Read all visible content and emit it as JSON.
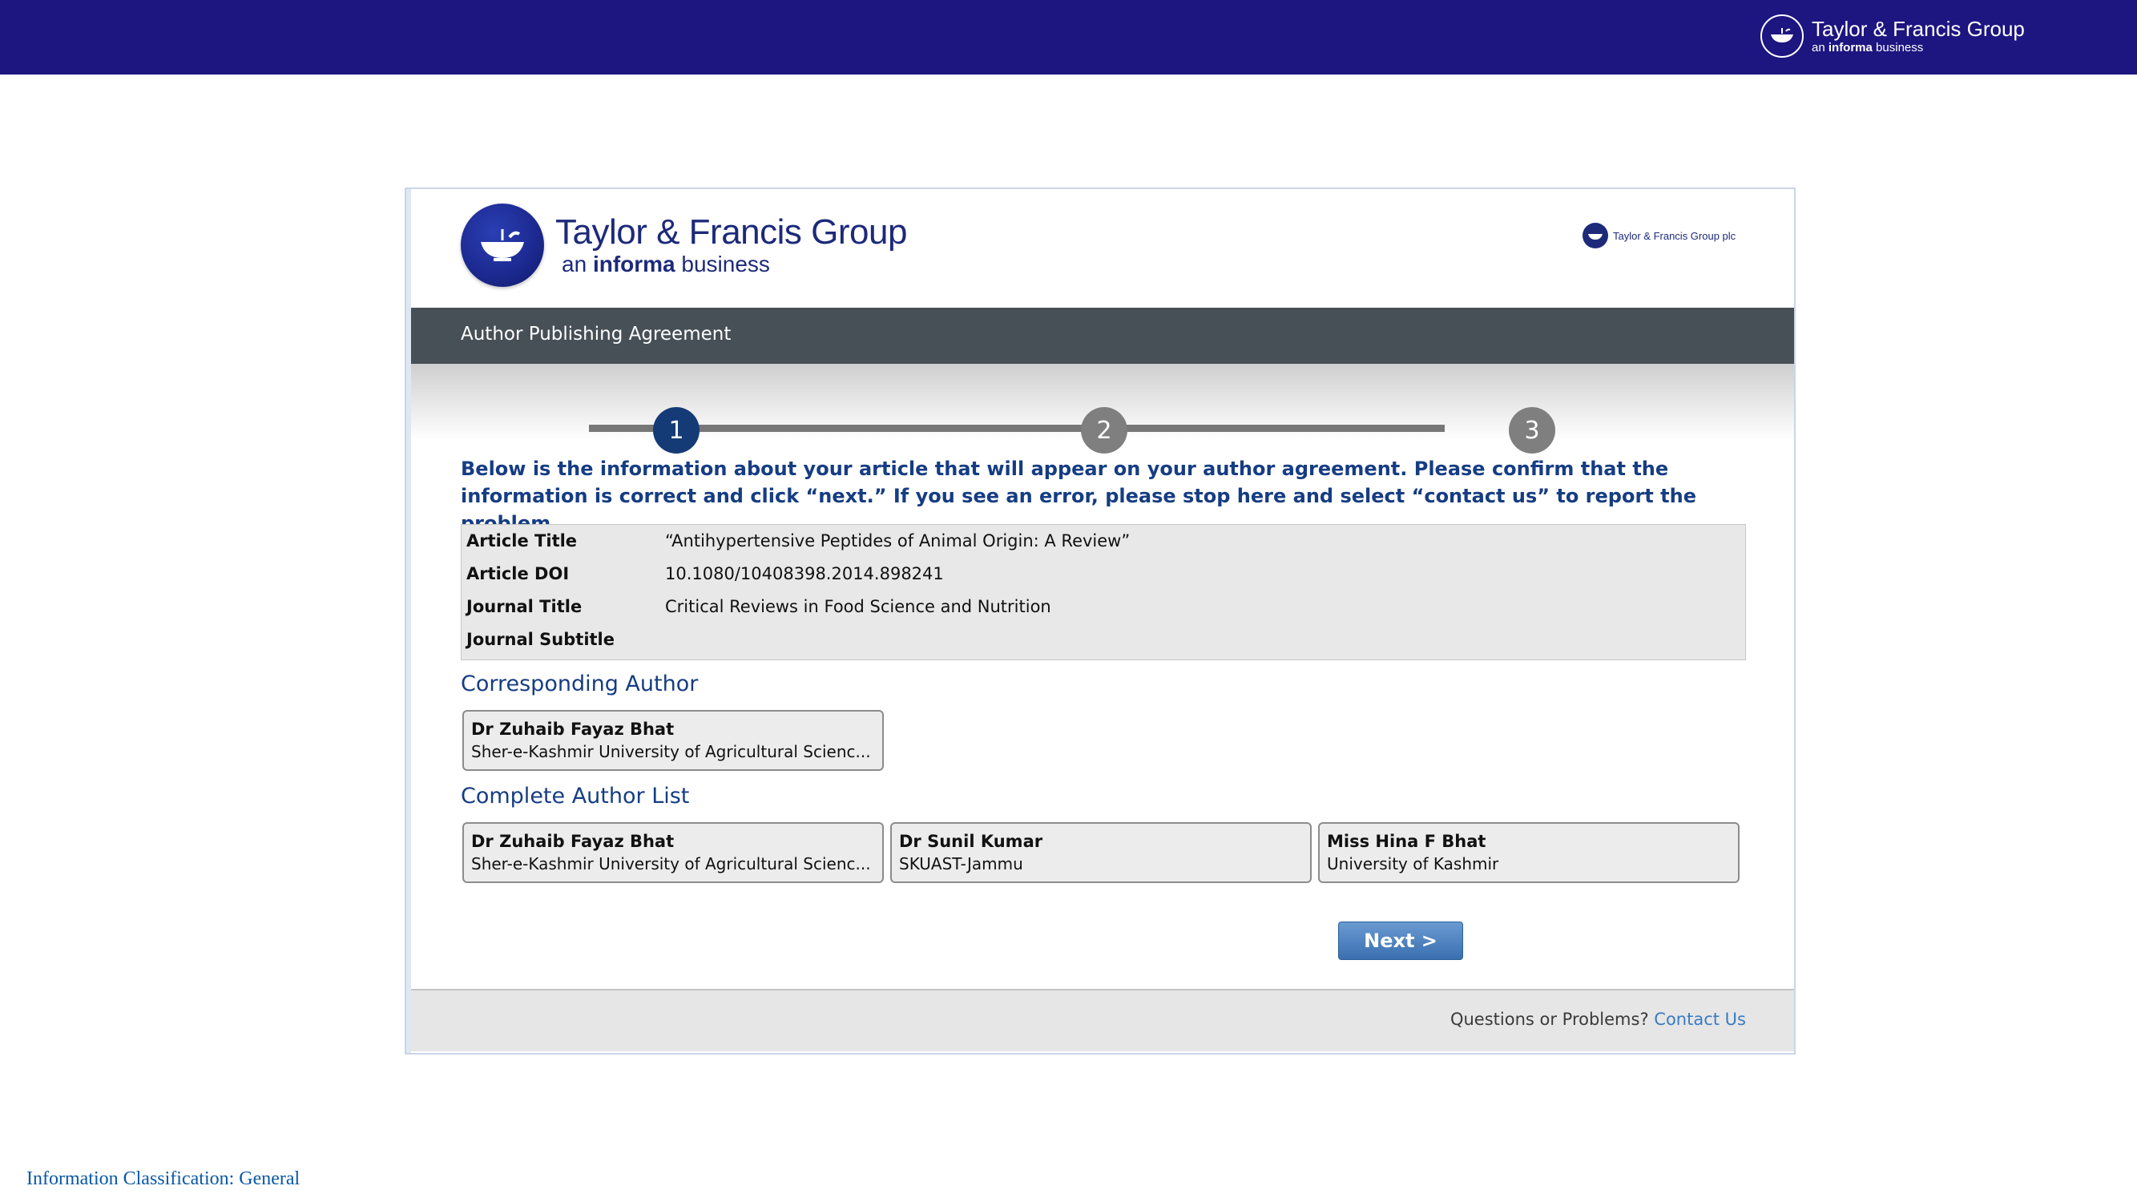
{
  "header": {
    "logo_title": "Taylor & Francis Group",
    "logo_sub_prefix": "an",
    "logo_sub_bold": "informa",
    "logo_sub_suffix": "business"
  },
  "panel": {
    "brand_title": "Taylor & Francis Group",
    "brand_sub_prefix": "an",
    "brand_sub_bold": "informa",
    "brand_sub_suffix": "business",
    "small_logo_text": "Taylor & Francis Group plc",
    "section_bar_title": "Author Publishing Agreement",
    "steps": [
      "1",
      "2",
      "3"
    ],
    "active_step": 1,
    "intro_text": "Below is the information about your article that will appear on your author agreement. Please confirm that the information is correct and click “next.” If you see an error, please stop here and select “contact us” to report the problem.",
    "article_info": [
      {
        "label": "Article Title",
        "value": "“Antihypertensive Peptides of Animal Origin: A Review”"
      },
      {
        "label": "Article DOI",
        "value": "10.1080/10408398.2014.898241"
      },
      {
        "label": "Journal Title",
        "value": "Critical Reviews in Food Science and Nutrition"
      },
      {
        "label": "Journal Subtitle",
        "value": ""
      }
    ],
    "corresponding_author_heading": "Corresponding Author",
    "corresponding_author": {
      "name": "Dr Zuhaib Fayaz Bhat",
      "affiliation": "Sher-e-Kashmir University of Agricultural Scienc..."
    },
    "author_list_heading": "Complete Author List",
    "authors": [
      {
        "name": "Dr Zuhaib Fayaz Bhat",
        "affiliation": "Sher-e-Kashmir University of Agricultural Scienc..."
      },
      {
        "name": "Dr Sunil Kumar",
        "affiliation": "SKUAST-Jammu"
      },
      {
        "name": "Miss Hina F Bhat",
        "affiliation": "University of Kashmir"
      }
    ],
    "next_button": "Next >",
    "footer_question": "Questions or Problems?",
    "footer_link": "Contact Us"
  },
  "classification": "Information Classification: General",
  "colors": {
    "top_bar": "#1d1580",
    "section_bar": "#474f57",
    "active_step": "#143b76",
    "inactive_step": "#7f7f7f",
    "intro_text": "#163d83",
    "link": "#3a7cc2"
  }
}
